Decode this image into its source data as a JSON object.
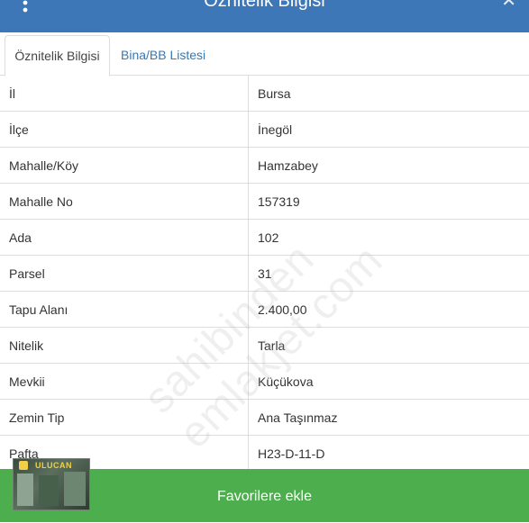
{
  "header": {
    "title": "Öznitelik Bilgisi",
    "menu_icon": "vertical-dots-icon",
    "close_icon": "close-icon",
    "color": "#3d77b8"
  },
  "tabs": [
    {
      "label": "Öznitelik Bilgisi",
      "active": true
    },
    {
      "label": "Bina/BB Listesi",
      "active": false
    }
  ],
  "attributes": [
    {
      "key": "İl",
      "value": "Bursa"
    },
    {
      "key": "İlçe",
      "value": "İnegöl"
    },
    {
      "key": "Mahalle/Köy",
      "value": "Hamzabey"
    },
    {
      "key": "Mahalle No",
      "value": "157319"
    },
    {
      "key": "Ada",
      "value": "102"
    },
    {
      "key": "Parsel",
      "value": "31"
    },
    {
      "key": "Tapu Alanı",
      "value": "2.400,00"
    },
    {
      "key": "Nitelik",
      "value": "Tarla"
    },
    {
      "key": "Mevkii",
      "value": "Küçükova"
    },
    {
      "key": "Zemin Tip",
      "value": "Ana Taşınmaz"
    },
    {
      "key": "Pafta",
      "value": "H23-D-11-D"
    }
  ],
  "watermark": "sahibinden emlakjet.com",
  "logo": {
    "text": "ULUCAN"
  },
  "footer": {
    "button_label": "Favorilere ekle",
    "color": "#4cae4c"
  }
}
